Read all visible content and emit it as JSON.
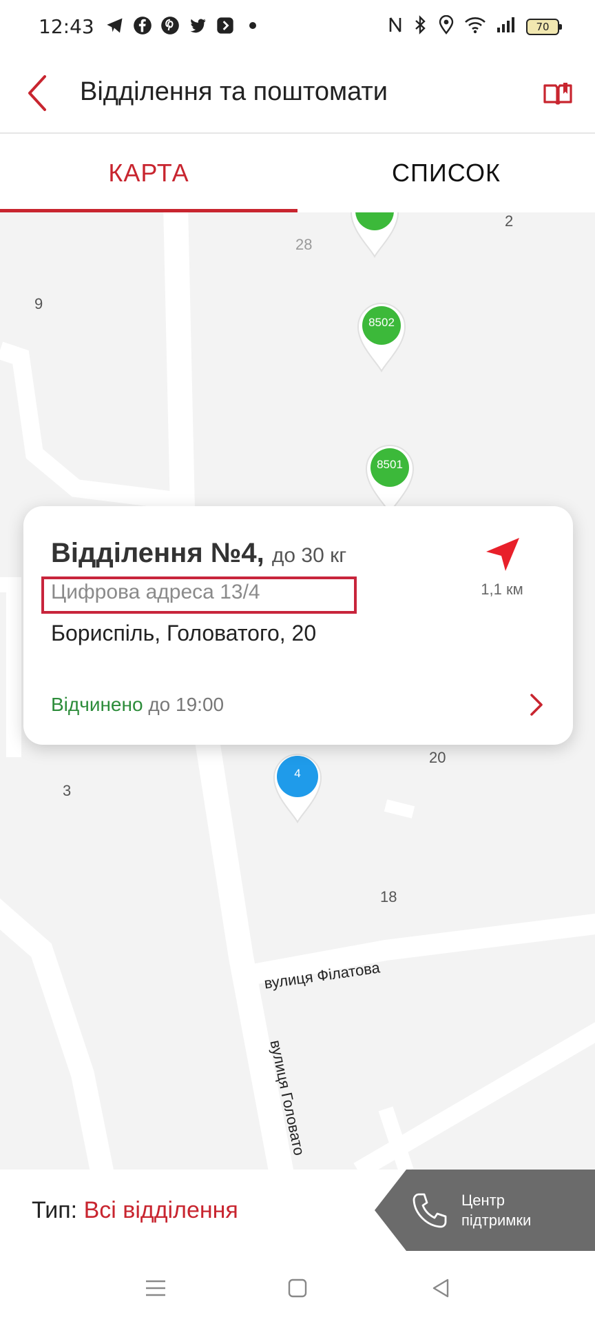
{
  "status_bar": {
    "time": "12:43",
    "left_icons": [
      "telegram-icon",
      "facebook-icon",
      "pinterest-icon",
      "twitter-icon",
      "app-icon",
      "dot-icon"
    ],
    "right_icons": [
      "nfc-icon",
      "bluetooth-icon",
      "location-icon",
      "wifi-icon",
      "signal-icon"
    ],
    "battery": "70"
  },
  "header": {
    "title": "Відділення та поштомати"
  },
  "tabs": [
    {
      "label": "КАРТА",
      "active": true
    },
    {
      "label": "СПИСОК",
      "active": false
    }
  ],
  "map": {
    "numbers": [
      "2",
      "28",
      "9",
      "20",
      "3",
      "18"
    ],
    "streets": [
      "вулиця Філатова",
      "вулиця Головато"
    ],
    "pins": [
      {
        "label": "",
        "color": "#3cb93a"
      },
      {
        "label": "8502",
        "color": "#3cb93a"
      },
      {
        "label": "8501",
        "color": "#3cb93a"
      },
      {
        "label": "4",
        "color": "#1f9bea"
      }
    ]
  },
  "card": {
    "title": "Відділення №4,",
    "weight": "до 30 кг",
    "digital_address": "Цифрова адреса 13/4",
    "address": "Бориспіль, Головатого, 20",
    "status_open": "Відчинено",
    "status_until": "до 19:00",
    "distance": "1,1 км"
  },
  "bottom": {
    "type_label": "Тип:",
    "type_value": "Всі відділення",
    "support_line1": "Центр",
    "support_line2": "підтримки"
  },
  "colors": {
    "brand_red": "#c8252f",
    "open_green": "#2c8c3a",
    "pin_green": "#3cb93a",
    "pin_blue": "#1f9bea"
  }
}
